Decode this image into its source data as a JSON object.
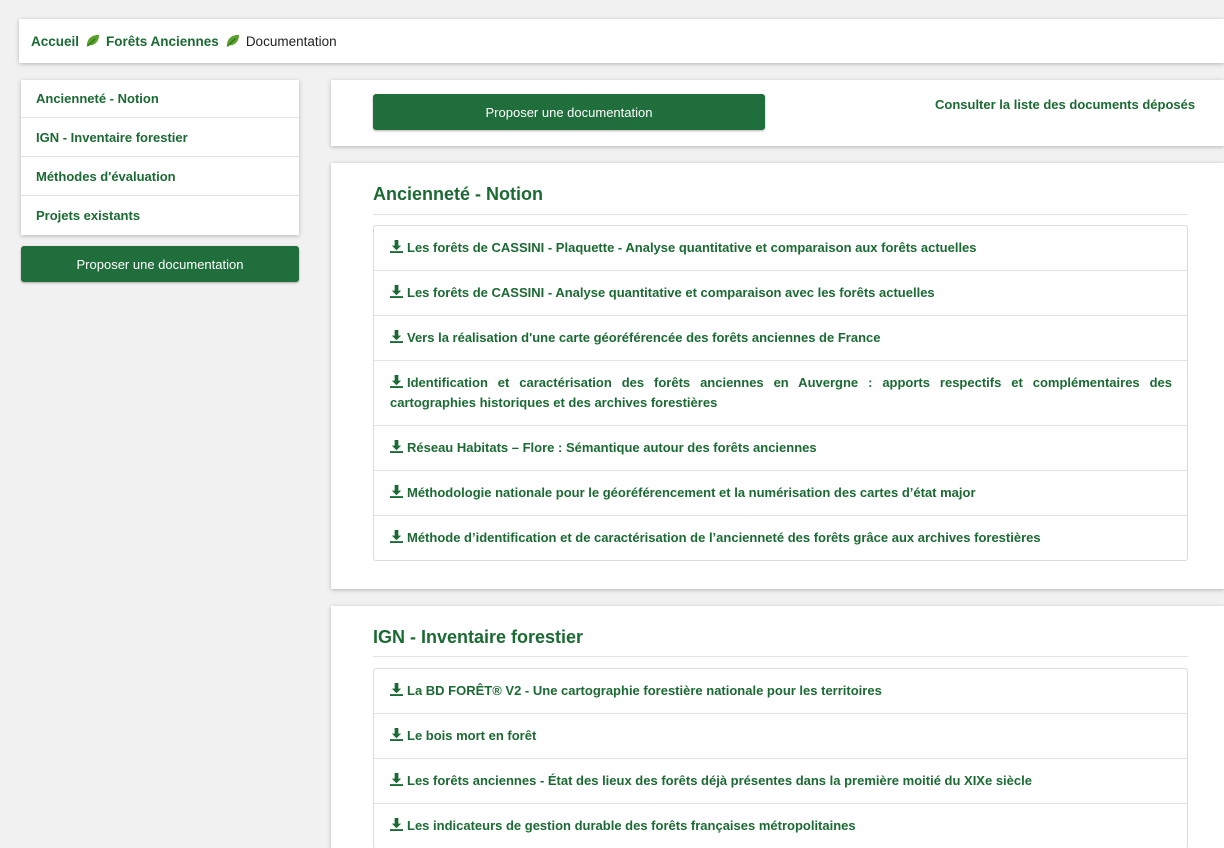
{
  "breadcrumb": {
    "home": "Accueil",
    "section": "Forêts Anciennes",
    "current": "Documentation"
  },
  "sidebar": {
    "items": [
      {
        "label": "Ancienneté - Notion"
      },
      {
        "label": "IGN - Inventaire forestier"
      },
      {
        "label": "Méthodes d'évaluation"
      },
      {
        "label": "Projets existants"
      }
    ],
    "button_label": "Proposer une documentation"
  },
  "topbar": {
    "button_label": "Proposer une documentation",
    "consult_link": "Consulter la liste des documents déposés"
  },
  "sections": [
    {
      "title": "Ancienneté - Notion",
      "documents": [
        "Les forêts de CASSINI - Plaquette - Analyse quantitative et comparaison aux forêts actuelles",
        "Les forêts de CASSINI - Analyse quantitative et comparaison avec les forêts actuelles",
        "Vers la réalisation d'une carte géoréférencée des forêts anciennes de France",
        "Identification et caractérisation des forêts anciennes en Auvergne : apports respectifs et complémentaires des cartographies historiques et des archives forestières",
        "Réseau Habitats – Flore : Sémantique autour des forêts anciennes",
        "Méthodologie nationale pour le géoréférencement et la numérisation des cartes d’état major",
        "Méthode d’identification et de caractérisation de l’ancienneté des forêts grâce aux archives forestières"
      ]
    },
    {
      "title": "IGN - Inventaire forestier",
      "documents": [
        "La BD FORÊT® V2 - Une cartographie forestière nationale pour les territoires",
        "Le bois mort en forêt",
        "Les forêts anciennes - État des lieux des forêts déjà présentes dans la première moitié du XIXe siècle",
        "Les indicateurs de gestion durable des forêts françaises métropolitaines"
      ]
    }
  ],
  "colors": {
    "brand_green": "#1f6e3b",
    "link_green": "#1b6a33",
    "leaf_green": "#5aa02c"
  },
  "icons": {
    "breadcrumb_separator": "leaf-icon",
    "document": "download-icon"
  }
}
